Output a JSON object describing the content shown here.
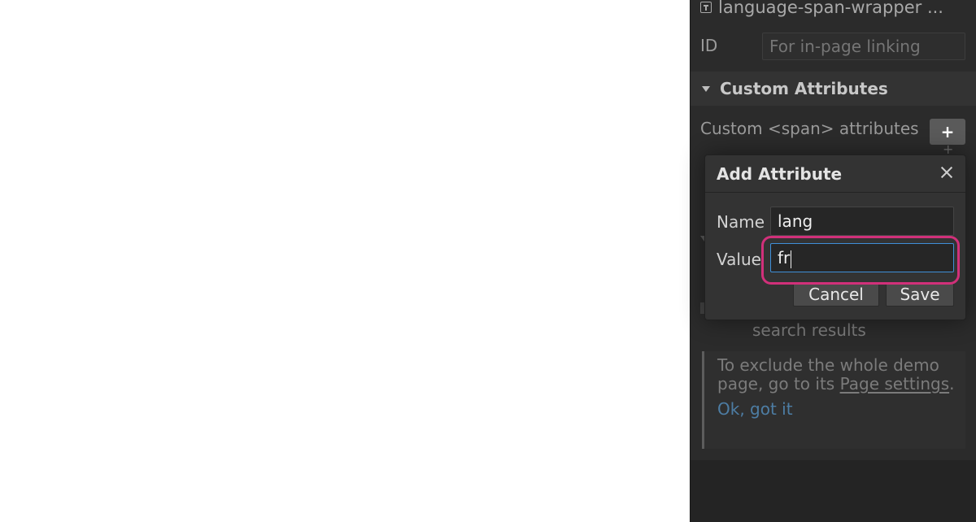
{
  "panel": {
    "wrapper_name": "language-span-wrapper ...",
    "id_label": "ID",
    "id_placeholder": "For in-page linking",
    "section_title": "Custom Attributes",
    "custom_attrs_label": "Custom <span> attributes",
    "add_label": "+",
    "search_results_text": "search results",
    "info": {
      "line1": "To exclude the whole demo page, go to its ",
      "link": "Page settings",
      "end": ".",
      "ok": "Ok, got it"
    }
  },
  "dialog": {
    "title": "Add Attribute",
    "name_label": "Name",
    "name_value": "lang",
    "value_label": "Value",
    "value_value": "fr",
    "cancel_label": "Cancel",
    "save_label": "Save"
  },
  "colors": {
    "panel_bg": "#2b2b2b",
    "focus_border": "#3f8fd8",
    "highlight": "#d1307a",
    "link": "#4d7da4"
  }
}
